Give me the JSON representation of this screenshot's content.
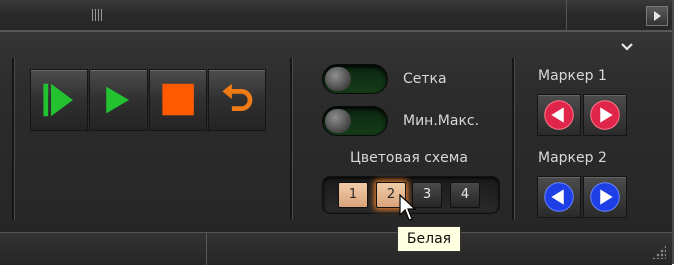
{
  "toggles": [
    {
      "label": "Сетка",
      "state": "off"
    },
    {
      "label": "Мин.Макс.",
      "state": "off"
    }
  ],
  "color_scheme": {
    "title": "Цветовая схема",
    "buttons": [
      "1",
      "2",
      "3",
      "4"
    ],
    "selected": "1",
    "hovered": "2",
    "tooltip": "Белая"
  },
  "markers": [
    {
      "label": "Маркер 1",
      "color": "#e0254a"
    },
    {
      "label": "Маркер 2",
      "color": "#1e3ee6"
    }
  ],
  "transport": {
    "buttons": [
      "play-from-start-icon",
      "play-icon",
      "stop-icon",
      "loop-icon"
    ],
    "play_color": "#22c230",
    "stop_color": "#ff5a00",
    "loop_color": "#f07a14"
  },
  "icons": {
    "collapse": "chevron-down-icon",
    "scroll_right": "triangle-right-icon"
  }
}
